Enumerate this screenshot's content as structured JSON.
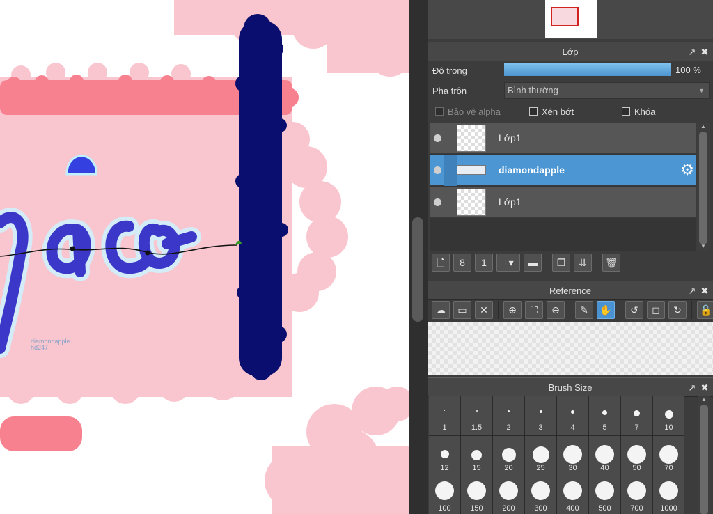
{
  "canvas": {
    "watermark_line1": "diamondapple",
    "watermark_line2": "hd247"
  },
  "layer_panel": {
    "title": "Lớp",
    "opacity_label": "Độ trong",
    "opacity_value": "100 %",
    "opacity_fraction": 1.0,
    "blend_label": "Pha trộn",
    "blend_value": "Bình thường",
    "protect_alpha_label": "Bảo vệ alpha",
    "clipping_label": "Xén bớt",
    "lock_label": "Khóa",
    "layers": [
      {
        "name": "Lớp1"
      },
      {
        "name": "diamondapple"
      },
      {
        "name": "Lớp1"
      }
    ]
  },
  "reference_panel": {
    "title": "Reference"
  },
  "brush_size_panel": {
    "title": "Brush Size",
    "sizes": [
      "1",
      "1.5",
      "2",
      "3",
      "4",
      "5",
      "7",
      "10",
      "12",
      "15",
      "20",
      "25",
      "30",
      "40",
      "50",
      "70",
      "100",
      "150",
      "200",
      "300",
      "400",
      "500",
      "700",
      "1000"
    ]
  },
  "icons": {
    "undock": "undock-icon",
    "close": "close-icon",
    "gear": "gear-icon"
  },
  "colors": {
    "accent": "#4c97d3",
    "canvas_pink": "#f8c7cf",
    "navy_stroke": "#0a0e6e"
  }
}
